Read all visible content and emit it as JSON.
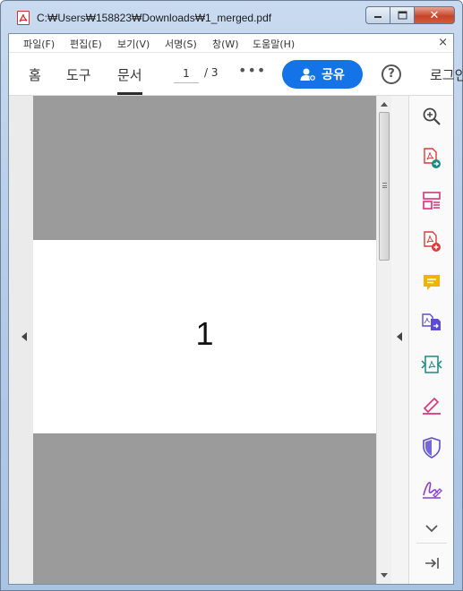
{
  "window": {
    "title": "C:₩Users₩158823₩Downloads₩1_merged.pdf"
  },
  "menu": {
    "items": [
      "파일(F)",
      "편집(E)",
      "보기(V)",
      "서명(S)",
      "창(W)",
      "도움말(H)"
    ],
    "close_glyph": "×"
  },
  "toolbar": {
    "tabs": [
      "홈",
      "도구",
      "문서"
    ],
    "active_tab": "문서",
    "page_current": "1",
    "page_total": "/ 3",
    "more": "•••",
    "share_label": "공유",
    "help": "?",
    "login": "로그인"
  },
  "document": {
    "page_number_text": "1"
  },
  "tools": [
    "zoom-icon",
    "export-pdf-icon",
    "organize-pages-icon",
    "create-pdf-icon",
    "comment-icon",
    "combine-files-icon",
    "compress-pdf-icon",
    "fill-sign-icon",
    "protect-icon",
    "request-signature-icon",
    "more-tools-icon",
    "collapse-pane-icon"
  ],
  "colors": {
    "accent": "#1473e6",
    "page_gray": "#9b9b9b"
  }
}
